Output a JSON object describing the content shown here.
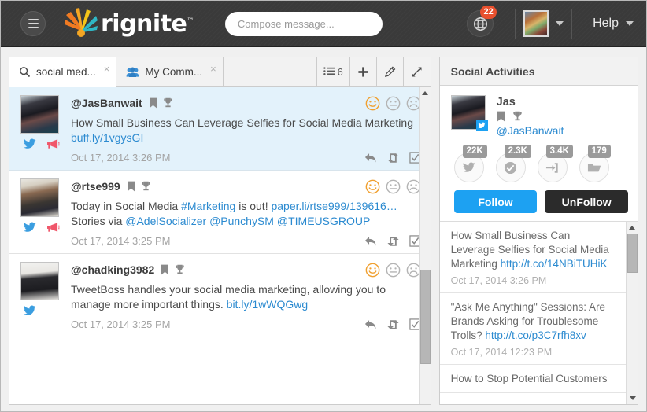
{
  "topnav": {
    "menu_icon": "hamburger-icon",
    "brand": "rignite",
    "brand_tm": "™",
    "compose_placeholder": "Compose message...",
    "notification_count": "22",
    "globe_icon": "globe-icon",
    "help_label": "Help"
  },
  "stream": {
    "tabs": [
      {
        "label": "social med...",
        "icon": "search-icon",
        "close": "×",
        "active": true
      },
      {
        "label": "My Comm...",
        "icon": "people-icon",
        "close": "×",
        "active": false
      }
    ],
    "toolbar": [
      {
        "name": "list-count-button",
        "icon": "list-icon",
        "label": "6"
      },
      {
        "name": "add-button",
        "icon": "plus-icon",
        "label": ""
      },
      {
        "name": "edit-button",
        "icon": "pencil-icon",
        "label": ""
      },
      {
        "name": "expand-button",
        "icon": "expand-arrows-icon",
        "label": ""
      }
    ],
    "posts": [
      {
        "handle": "@JasBanwait",
        "text_parts": [
          {
            "t": "How Small Business Can Leverage Selfies for Social Media Marketing ",
            "link": false
          },
          {
            "t": "buff.ly/1vgysGI",
            "link": true
          }
        ],
        "time": "Oct 17, 2014 3:26 PM",
        "selected": true,
        "networks": [
          "twitter-icon",
          "megaphone-icon"
        ],
        "mood_active": "happy"
      },
      {
        "handle": "@rtse999",
        "text_parts": [
          {
            "t": "Today in Social Media ",
            "link": false
          },
          {
            "t": "#Marketing",
            "link": true
          },
          {
            "t": " is out! ",
            "link": false
          },
          {
            "t": "paper.li/rtse999/139616…",
            "link": true
          },
          {
            "t": " Stories via ",
            "link": false
          },
          {
            "t": "@AdelSocializer",
            "link": true
          },
          {
            "t": " ",
            "link": false
          },
          {
            "t": "@PunchySM",
            "link": true
          },
          {
            "t": " ",
            "link": false
          },
          {
            "t": "@TIMEUSGROUP",
            "link": true
          }
        ],
        "time": "Oct 17, 2014 3:25 PM",
        "selected": false,
        "networks": [
          "twitter-icon",
          "megaphone-icon"
        ],
        "mood_active": "happy"
      },
      {
        "handle": "@chadking3982",
        "text_parts": [
          {
            "t": "TweetBoss handles your social media marketing, allowing you to manage more important things. ",
            "link": false
          },
          {
            "t": "bit.ly/1wWQGwg",
            "link": true
          }
        ],
        "time": "Oct 17, 2014 3:25 PM",
        "selected": false,
        "networks": [
          "twitter-icon"
        ],
        "mood_active": "happy"
      }
    ],
    "post_actions": [
      "reply-icon",
      "retweet-icon",
      "checkbox-icon"
    ],
    "header_icons": [
      "bookmark-icon",
      "trophy-icon"
    ],
    "moods": [
      "happy-face-icon",
      "neutral-face-icon",
      "sad-face-icon"
    ]
  },
  "sidebar": {
    "title": "Social Activities",
    "profile": {
      "name": "Jas",
      "handle": "@JasBanwait",
      "network_badge": "twitter-icon",
      "icons": [
        "bookmark-icon",
        "trophy-icon"
      ]
    },
    "stats": [
      {
        "value": "22K",
        "icon": "twitter-icon",
        "name": "tweets-stat"
      },
      {
        "value": "2.3K",
        "icon": "check-icon",
        "name": "following-stat"
      },
      {
        "value": "3.4K",
        "icon": "signin-icon",
        "name": "followers-stat"
      },
      {
        "value": "179",
        "icon": "folder-icon",
        "name": "lists-stat"
      }
    ],
    "follow_label": "Follow",
    "unfollow_label": "UnFollow",
    "activities": [
      {
        "text_parts": [
          {
            "t": "How Small Business Can Leverage Selfies for Social Media Marketing ",
            "link": false
          },
          {
            "t": "http://t.co/14NBiTUHiK",
            "link": true
          }
        ],
        "time": "Oct 17, 2014 3:26 PM"
      },
      {
        "text_parts": [
          {
            "t": "\"Ask Me Anything\" Sessions: Are Brands Asking for Troublesome Trolls? ",
            "link": false
          },
          {
            "t": "http://t.co/p3C7rfh8xv",
            "link": true
          }
        ],
        "time": "Oct 17, 2014 12:23 PM"
      },
      {
        "text_parts": [
          {
            "t": "How to Stop Potential Customers",
            "link": false
          }
        ],
        "time": ""
      }
    ]
  },
  "colors": {
    "accent_blue": "#2b8ad0",
    "twitter_blue": "#1da1f2",
    "badge_red": "#e8502e",
    "mood_orange": "#f0a030",
    "selected_row": "#e3f2fb",
    "navbar_dark": "#3a3a3a"
  }
}
